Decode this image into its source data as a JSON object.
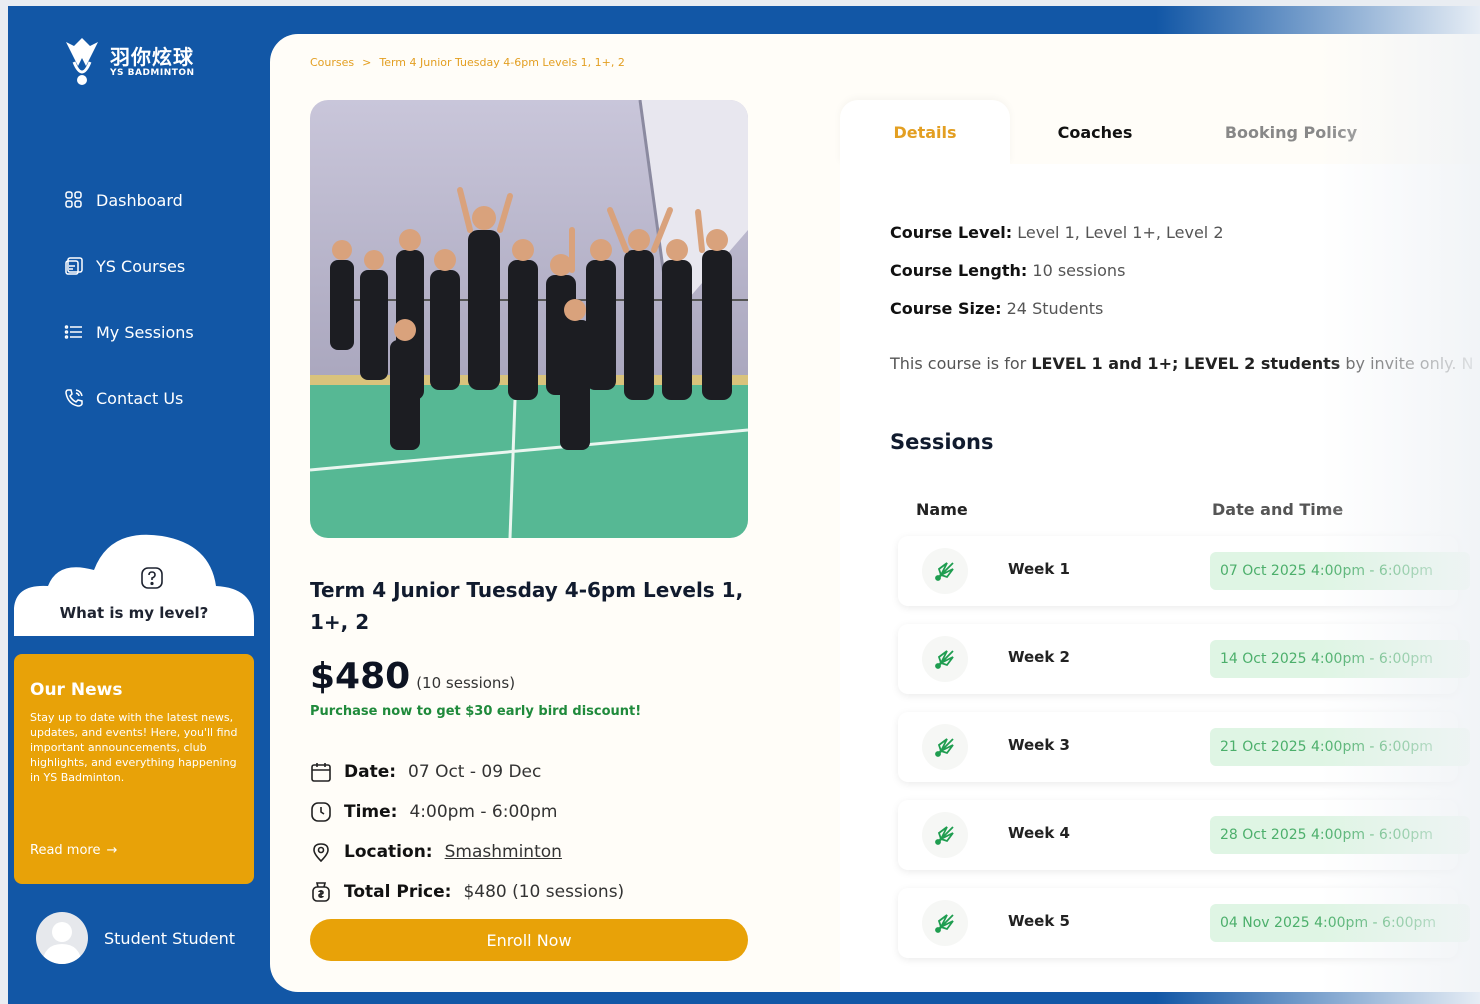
{
  "brand": {
    "name_cn": "羽你炫球",
    "name_en": "YS BADMINTON"
  },
  "colors": {
    "primary": "#1257a6",
    "accent": "#e8a208",
    "success": "#1f8a3b"
  },
  "sidebar": {
    "items": [
      {
        "label": "Dashboard",
        "icon": "dashboard-icon"
      },
      {
        "label": "YS Courses",
        "icon": "courses-icon"
      },
      {
        "label": "My Sessions",
        "icon": "list-icon"
      },
      {
        "label": "Contact Us",
        "icon": "phone-icon"
      }
    ],
    "level_help": "What is my level?",
    "news": {
      "title": "Our News",
      "body": "Stay up to date with the latest news, updates, and events! Here, you'll find important announcements, club highlights, and everything happening in YS Badminton.",
      "read_more": "Read more"
    },
    "user": {
      "name": "Student Student"
    }
  },
  "breadcrumb": {
    "root": "Courses",
    "separator": ">",
    "current": "Term 4 Junior Tuesday 4-6pm Levels 1, 1+, 2"
  },
  "course": {
    "title": "Term 4 Junior Tuesday 4-6pm Levels 1, 1+, 2",
    "price": "$480",
    "price_note": "(10 sessions)",
    "discount": "Purchase now to get $30 early bird discount!",
    "date_label": "Date:",
    "date": "07 Oct - 09 Dec",
    "time_label": "Time:",
    "time": "4:00pm - 6:00pm",
    "location_label": "Location:",
    "location": "Smashminton",
    "total_label": "Total Price:",
    "total": "$480 (10 sessions)",
    "enroll": "Enroll Now"
  },
  "tabs": {
    "details": "Details",
    "coaches": "Coaches",
    "policy": "Booking Policy"
  },
  "details": {
    "level_label": "Course Level:",
    "level": "Level 1, Level 1+, Level 2",
    "length_label": "Course Length:",
    "length": "10 sessions",
    "size_label": "Course Size:",
    "size": "24 Students",
    "desc_prefix": "This course is for",
    "desc_bold": "LEVEL 1 and 1+; LEVEL 2 students",
    "desc_suffix": "by invite only. N"
  },
  "sessions": {
    "title": "Sessions",
    "col_name": "Name",
    "col_datetime": "Date and Time",
    "rows": [
      {
        "name": "Week 1",
        "datetime": "07 Oct 2025 4:00pm - 6:00pm"
      },
      {
        "name": "Week 2",
        "datetime": "14 Oct 2025 4:00pm - 6:00pm"
      },
      {
        "name": "Week 3",
        "datetime": "21 Oct 2025 4:00pm - 6:00pm"
      },
      {
        "name": "Week 4",
        "datetime": "28 Oct 2025 4:00pm - 6:00pm"
      },
      {
        "name": "Week 5",
        "datetime": "04 Nov 2025 4:00pm - 6:00pm"
      }
    ]
  }
}
